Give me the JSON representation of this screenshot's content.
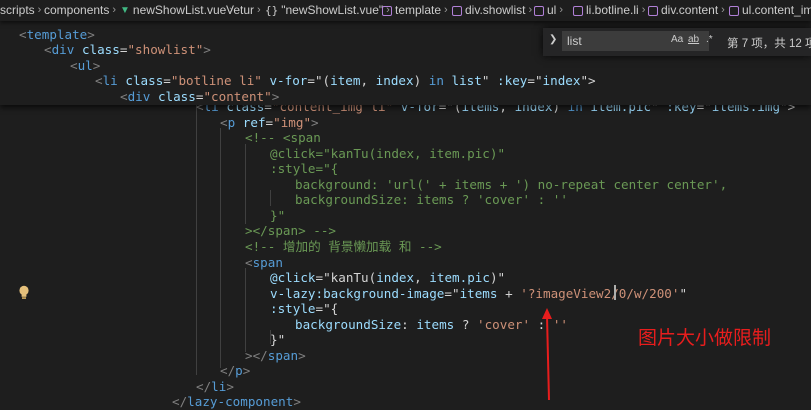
{
  "breadcrumb": {
    "items": [
      "scripts",
      "components",
      "newShowList.vue",
      "Vetur",
      "\"newShowList.vue\"",
      "template",
      "div.showlist",
      "ul",
      "li.botline.li",
      "div.content",
      "ul.content_im"
    ]
  },
  "find_widget": {
    "toggle_icon": "chevron-right-icon",
    "query": "list",
    "match_case_label": "Aa",
    "whole_word_label": "ab",
    "regex_label": ".*",
    "result_count": "第 7 项，共 12 项"
  },
  "code": {
    "sticky": [
      [
        [
          "t-tag",
          "<"
        ],
        [
          "t-name",
          "template"
        ],
        [
          "t-tag",
          ">"
        ]
      ],
      [
        [
          "t-tag",
          "<"
        ],
        [
          "t-name",
          "div"
        ],
        [
          "t-plain",
          " "
        ],
        [
          "t-attr",
          "class"
        ],
        [
          "t-plain",
          "="
        ],
        [
          "t-str",
          "\"showlist\""
        ],
        [
          "t-tag",
          ">"
        ]
      ],
      [
        [
          "t-tag",
          "<"
        ],
        [
          "t-name",
          "ul"
        ],
        [
          "t-tag",
          ">"
        ]
      ],
      [
        [
          "t-tag",
          "<"
        ],
        [
          "t-name",
          "li"
        ],
        [
          "t-plain",
          " "
        ],
        [
          "t-attr",
          "class"
        ],
        [
          "t-plain",
          "="
        ],
        [
          "t-str",
          "\"botline li\""
        ],
        [
          "t-plain",
          " "
        ],
        [
          "t-attr",
          "v-for"
        ],
        [
          "t-plain",
          "=\"("
        ],
        [
          "t-var",
          "item"
        ],
        [
          "t-plain",
          ", "
        ],
        [
          "t-var",
          "index"
        ],
        [
          "t-plain",
          ") "
        ],
        [
          "t-kw",
          "in"
        ],
        [
          "t-plain",
          " "
        ],
        [
          "t-var",
          "list"
        ],
        [
          "t-plain",
          "\" "
        ],
        [
          "t-attr",
          ":key"
        ],
        [
          "t-plain",
          "=\""
        ],
        [
          "t-var",
          "index"
        ],
        [
          "t-plain",
          "\">"
        ]
      ],
      [
        [
          "t-tag",
          "<"
        ],
        [
          "t-name",
          "div"
        ],
        [
          "t-plain",
          " "
        ],
        [
          "t-attr",
          "class"
        ],
        [
          "t-plain",
          "="
        ],
        [
          "t-str",
          "\"content\""
        ],
        [
          "t-tag",
          ">"
        ]
      ]
    ],
    "body": [
      [
        [
          "t-tag",
          "<"
        ],
        [
          "t-name",
          "li"
        ],
        [
          "t-plain",
          " "
        ],
        [
          "t-attr",
          "class"
        ],
        [
          "t-plain",
          "="
        ],
        [
          "t-str",
          "\"content_img li\""
        ],
        [
          "t-plain",
          " "
        ],
        [
          "t-attr",
          "v-for"
        ],
        [
          "t-plain",
          "=\"("
        ],
        [
          "t-var",
          "items"
        ],
        [
          "t-plain",
          ", "
        ],
        [
          "t-var",
          "index"
        ],
        [
          "t-plain",
          ") "
        ],
        [
          "t-kw",
          "in"
        ],
        [
          "t-plain",
          " "
        ],
        [
          "t-var",
          "item.pic"
        ],
        [
          "t-plain",
          "\" "
        ],
        [
          "t-attr",
          ":key"
        ],
        [
          "t-plain",
          "=\""
        ],
        [
          "t-var",
          "items.img"
        ],
        [
          "t-plain",
          "\">"
        ]
      ],
      [
        [
          "t-tag",
          "<"
        ],
        [
          "t-name",
          "p"
        ],
        [
          "t-plain",
          " "
        ],
        [
          "t-attr",
          "ref"
        ],
        [
          "t-plain",
          "="
        ],
        [
          "t-str",
          "\"img\""
        ],
        [
          "t-tag",
          ">"
        ]
      ],
      [
        [
          "t-cmt",
          "<!-- <span"
        ]
      ],
      [
        [
          "t-cmt",
          "@click=\"kanTu(index, item.pic)\""
        ]
      ],
      [
        [
          "t-cmt",
          ":style=\"{"
        ]
      ],
      [
        [
          "t-cmt",
          "background: 'url(' + items + ') no-repeat center center',"
        ]
      ],
      [
        [
          "t-cmt",
          "backgroundSize: items ? 'cover' : ''"
        ]
      ],
      [
        [
          "t-cmt",
          "}\""
        ]
      ],
      [
        [
          "t-cmt",
          "></span> -->"
        ]
      ],
      [
        [
          "t-cmt",
          "<!-- 增加的 背景懒加载 和 -->"
        ]
      ],
      [
        [
          "t-tag",
          "<"
        ],
        [
          "t-name",
          "span"
        ]
      ],
      [
        [
          "t-attr",
          "@click"
        ],
        [
          "t-plain",
          "=\""
        ],
        [
          "t-plain",
          "kanTu"
        ],
        [
          "t-plain",
          "("
        ],
        [
          "t-var",
          "index"
        ],
        [
          "t-plain",
          ", "
        ],
        [
          "t-var",
          "item.pic"
        ],
        [
          "t-plain",
          ")\""
        ]
      ],
      [
        [
          "t-attr",
          "v-lazy:background-image"
        ],
        [
          "t-plain",
          "=\""
        ],
        [
          "t-var",
          "items"
        ],
        [
          "t-plain",
          " + "
        ],
        [
          "t-str",
          "'?imageView2/0/w/200'"
        ],
        [
          "t-plain",
          "\""
        ]
      ],
      [
        [
          "t-attr",
          ":style"
        ],
        [
          "t-plain",
          "=\"{"
        ]
      ],
      [
        [
          "t-var",
          "backgroundSize"
        ],
        [
          "t-plain",
          ": "
        ],
        [
          "t-var",
          "items"
        ],
        [
          "t-plain",
          " ? "
        ],
        [
          "t-str",
          "'cover'"
        ],
        [
          "t-plain",
          " : "
        ],
        [
          "t-str",
          "''"
        ]
      ],
      [
        [
          "t-plain",
          "}\""
        ]
      ],
      [
        [
          "t-tag",
          "></"
        ],
        [
          "t-name",
          "span"
        ],
        [
          "t-tag",
          ">"
        ]
      ],
      [
        [
          "t-tag",
          "</"
        ],
        [
          "t-name",
          "p"
        ],
        [
          "t-tag",
          ">"
        ]
      ],
      [
        [
          "t-tag",
          "</"
        ],
        [
          "t-name",
          "li"
        ],
        [
          "t-tag",
          ">"
        ]
      ],
      [
        [
          "t-tag",
          "</"
        ],
        [
          "t-name",
          "lazy-component"
        ],
        [
          "t-tag",
          ">"
        ]
      ]
    ]
  },
  "annotation": {
    "text": "图片大小做限制",
    "color": "#e81d1d"
  }
}
